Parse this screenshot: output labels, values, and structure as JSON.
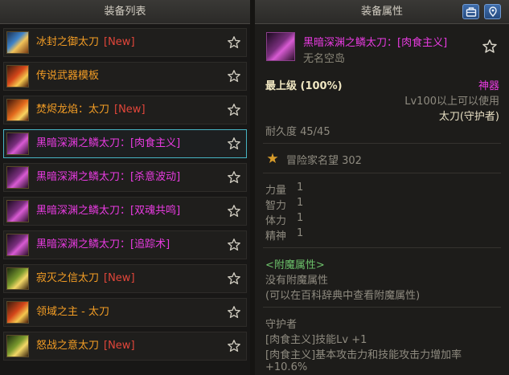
{
  "left_panel": {
    "title": "装备列表",
    "items": [
      {
        "name": "冰封之御太刀",
        "tag": "[New]",
        "rarity": "legend",
        "icon": "ice-katana-icon"
      },
      {
        "name": "传说武器模板",
        "tag": "",
        "rarity": "legend",
        "icon": "fire-katana-icon"
      },
      {
        "name": "焚烬龙焰：太刀",
        "tag": "[New]",
        "rarity": "legend",
        "icon": "flame-katana-icon"
      },
      {
        "name": "黑暗深渊之鳞太刀：[肉食主义]",
        "tag": "",
        "rarity": "epic",
        "icon": "abyss-katana-icon",
        "selected": true
      },
      {
        "name": "黑暗深渊之鳞太刀：[杀意波动]",
        "tag": "",
        "rarity": "epic",
        "icon": "abyss-katana-icon"
      },
      {
        "name": "黑暗深渊之鳞太刀：[双魂共鸣]",
        "tag": "",
        "rarity": "epic",
        "icon": "abyss-katana-icon"
      },
      {
        "name": "黑暗深渊之鳞太刀：[追踪术]",
        "tag": "",
        "rarity": "epic",
        "icon": "abyss-katana-icon"
      },
      {
        "name": "寂灭之信太刀",
        "tag": "[New]",
        "rarity": "legend",
        "icon": "green-katana-icon"
      },
      {
        "name": "领域之主 - 太刀",
        "tag": "",
        "rarity": "legend",
        "icon": "fire-katana-icon"
      },
      {
        "name": "怒战之意太刀",
        "tag": "[New]",
        "rarity": "legend",
        "icon": "green-katana-icon"
      }
    ]
  },
  "right_panel": {
    "title": "装备属性",
    "item": {
      "title": "黑暗深渊之鳞太刀：[肉食主义]",
      "subtitle": "无名空岛",
      "grade": "最上级 (100%)",
      "rarity": "神器",
      "level_req": "Lv100以上可以使用",
      "type": "太刀(守护者)",
      "durability": "耐久度 45/45",
      "fame": "冒险家名望 302",
      "stats": [
        {
          "name": "力量",
          "value": "1"
        },
        {
          "name": "智力",
          "value": "1"
        },
        {
          "name": "体力",
          "value": "1"
        },
        {
          "name": "精神",
          "value": "1"
        }
      ],
      "enchant_title": "<附魔属性>",
      "enchant_none": "没有附魔属性",
      "enchant_hint": "(可以在百科辞典中查看附魔属性)",
      "class_name": "守护者",
      "skill_1": "[肉食主义]技能Lv +1",
      "skill_2": "[肉食主义]基本攻击力和技能攻击力增加率",
      "skill_3": "+10.6%"
    }
  },
  "colors": {
    "legend": "#f39d25",
    "epic": "#e93be1",
    "new": "#e2463a",
    "selected_border": "#47b4c4",
    "enchant": "#6cc06a"
  }
}
